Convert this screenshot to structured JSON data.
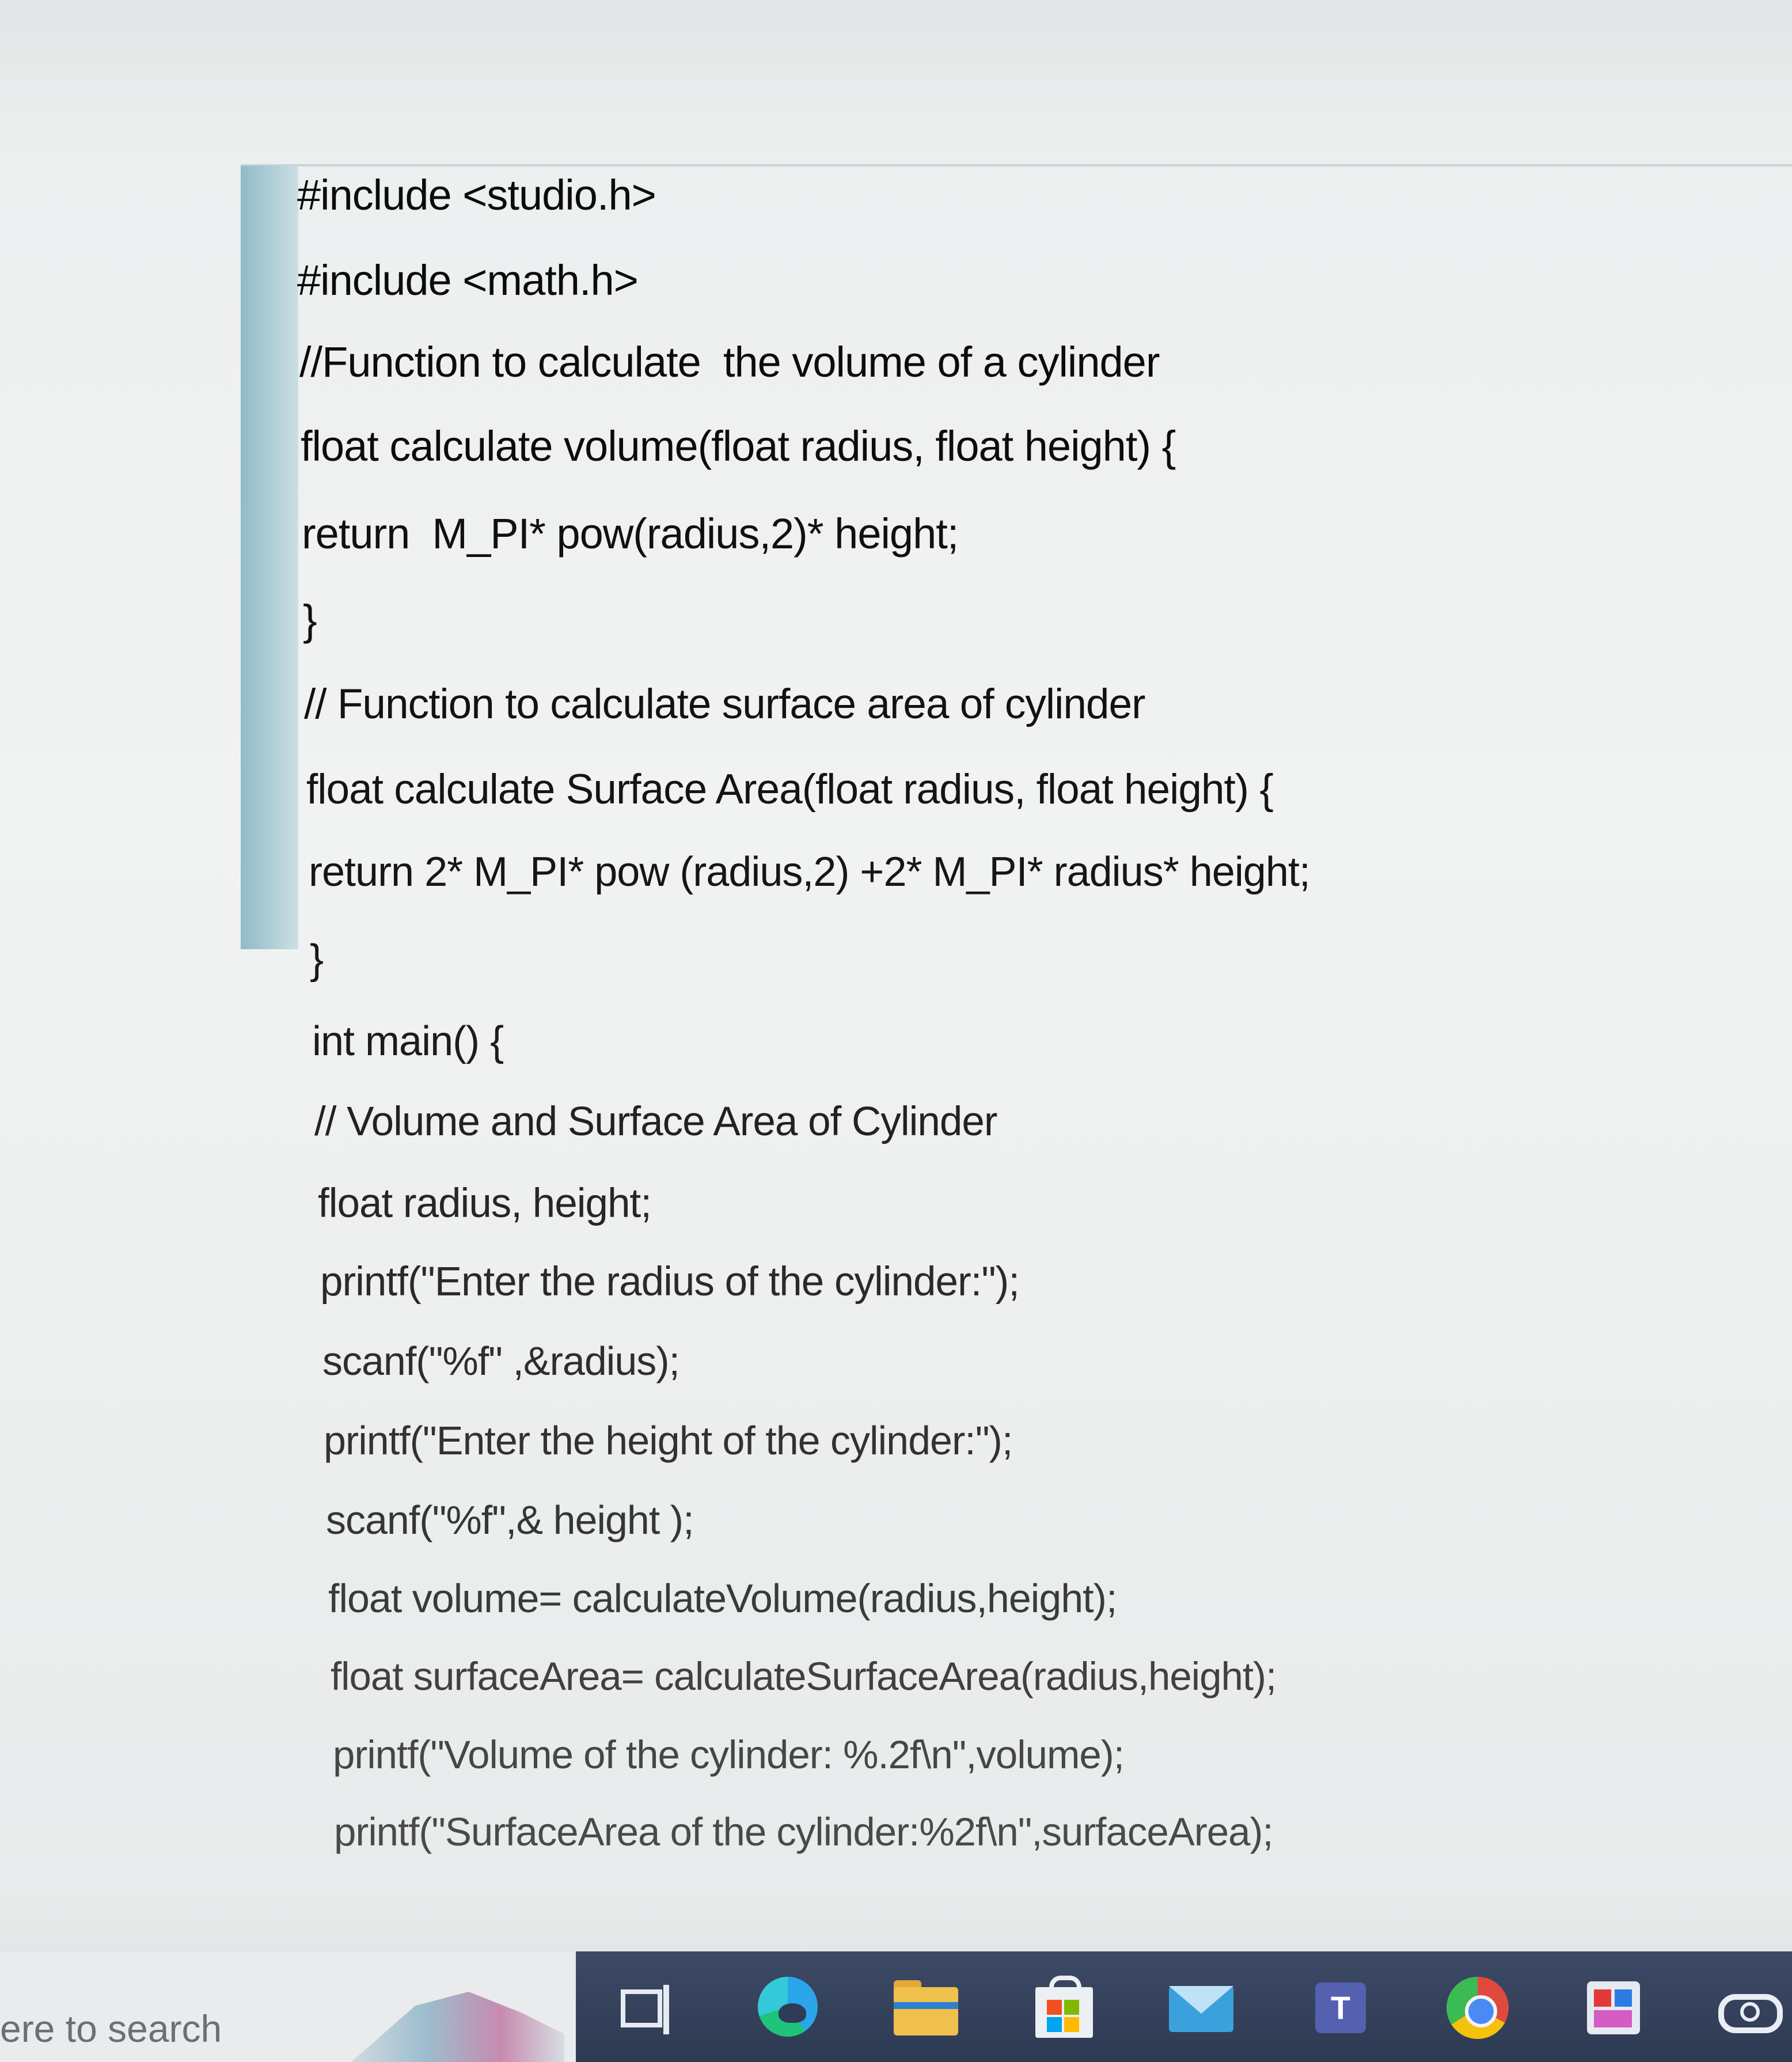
{
  "document": {
    "lines": [
      "#include <studio.h>",
      "#include <math.h>",
      "//Function to calculate  the volume of a cylinder",
      "float calculate volume(float radius, float height) {",
      "return  M_PI* pow(radius,2)* height;",
      "}",
      "// Function to calculate surface area of cylinder",
      "float calculate Surface Area(float radius, float height) {",
      "return 2* M_PI* pow (radius,2) +2* M_PI* radius* height;",
      "}",
      "int main() {",
      "// Volume and Surface Area of Cylinder",
      "float radius, height;",
      "printf(\"Enter the radius of the cylinder:\");",
      "scanf(\"%f\" ,&radius);",
      "printf(\"Enter the height of the cylinder:\");",
      "scanf(\"%f\",& height );",
      "float volume= calculateVolume(radius,height);",
      "float surfaceArea= calculateSurfaceArea(radius,height);",
      "printf(\"Volume of the cylinder: %.2f\\n\",volume);",
      "printf(\"SurfaceArea of the cylinder:%2f\\n\",surfaceArea);"
    ]
  },
  "taskbar": {
    "search_text": "ere to search",
    "icons": [
      "task-view-icon",
      "edge-icon",
      "file-explorer-icon",
      "store-icon",
      "mail-icon",
      "teams-icon",
      "chrome-icon",
      "app-icon",
      "onedrive-icon"
    ],
    "teams_letter": "T"
  },
  "colors": {
    "taskbar": "#2e3a52",
    "selection_bar": "#a9cbd4",
    "text": "#151515"
  }
}
